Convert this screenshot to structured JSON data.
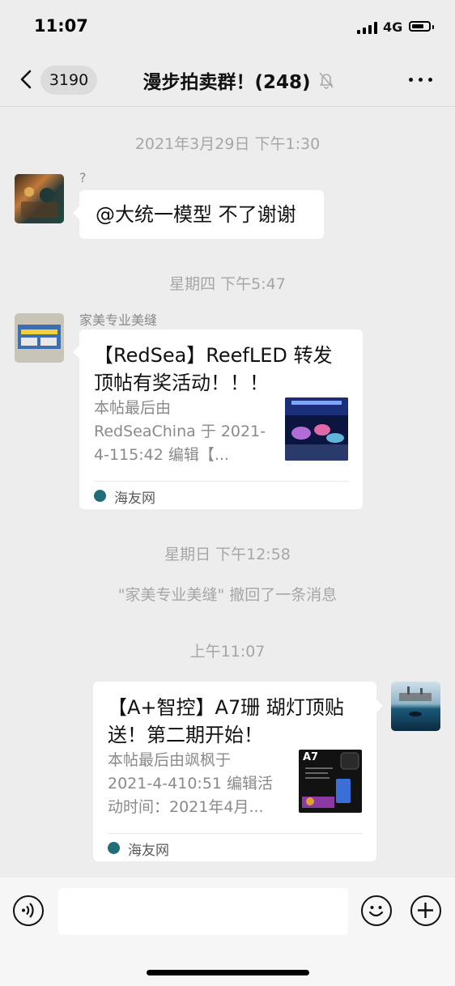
{
  "status_bar": {
    "time": "11:07",
    "network": "4G"
  },
  "header": {
    "back_count": "3190",
    "title": "漫步拍卖群！(248)"
  },
  "messages": [
    {
      "type": "timestamp",
      "text": "2021年3月29日 下午1:30"
    },
    {
      "type": "text",
      "side": "left",
      "sender": "?",
      "text": "@大统一模型 不了谢谢"
    },
    {
      "type": "timestamp",
      "text": "星期四 下午5:47"
    },
    {
      "type": "card",
      "side": "left",
      "sender": "家美专业美缝",
      "title_lines": [
        "【RedSea】ReefLED 转发",
        "顶帖有奖活动！！！"
      ],
      "desc_lines": [
        "本帖最后由",
        "RedSeaChina 于 2021-",
        "4-115:42 编辑【..."
      ],
      "source": "海友网"
    },
    {
      "type": "timestamp",
      "text": "星期日 下午12:58"
    },
    {
      "type": "system",
      "text": "\"家美专业美缝\" 撤回了一条消息"
    },
    {
      "type": "timestamp",
      "text": "上午11:07"
    },
    {
      "type": "card",
      "side": "right",
      "title_lines": [
        "【A+智控】A7珊 瑚灯顶贴",
        "送！第二期开始！"
      ],
      "desc_lines": [
        "本帖最后由飒枫于",
        "2021-4-410:51 编辑活",
        "动时间：2021年4月..."
      ],
      "thumb_label": "A7",
      "source": "海友网"
    }
  ],
  "icons": {
    "back": "chevron-left-icon",
    "mute": "bell-off-icon",
    "more": "more-dots-icon",
    "voice": "voice-icon",
    "emoji": "emoji-icon",
    "plus": "plus-icon",
    "source": "haiyou-logo-icon"
  }
}
